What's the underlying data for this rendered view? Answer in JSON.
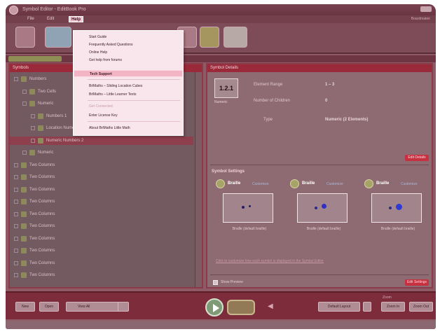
{
  "app": {
    "title": "Symbol Editor - EditBook Pro"
  },
  "menubar": {
    "file": "File",
    "edit": "Edit",
    "help": "Help",
    "right_text": "Boardmaker"
  },
  "help_menu": {
    "items": [
      {
        "label": "Start Guide"
      },
      {
        "label": "Frequently Asked Questions"
      },
      {
        "label": "Online Help"
      },
      {
        "label": "Get help from forums"
      },
      {
        "label": "Tech Support",
        "highlighted": true
      },
      {
        "label": "BrlMaths – Sliding Location Cubes"
      },
      {
        "label": "BrlMaths – Little Learner Texts"
      },
      {
        "label": "Get Connected",
        "disabled": true
      },
      {
        "label": "Enter License Key"
      },
      {
        "label": "About BrlMaths Little Math"
      }
    ]
  },
  "left_panel": {
    "header": "Symbols",
    "tree": [
      {
        "label": "Numbers",
        "level": 0
      },
      {
        "label": "Two Cells",
        "level": 1
      },
      {
        "label": "Numeric",
        "level": 1
      },
      {
        "label": "Numbers 1",
        "level": 2
      },
      {
        "label": "Location Numeric",
        "level": 2
      },
      {
        "label": "Numeric Numbers 2",
        "level": 2,
        "selected": true
      },
      {
        "label": "Numeric",
        "level": 1
      },
      {
        "label": "Two Columns",
        "level": 0
      },
      {
        "label": "Two Columns",
        "level": 0
      },
      {
        "label": "Two Columns",
        "level": 0
      },
      {
        "label": "Two Columns",
        "level": 0
      },
      {
        "label": "Two Columns",
        "level": 0
      },
      {
        "label": "Two Columns",
        "level": 0
      },
      {
        "label": "Two Columns",
        "level": 0
      },
      {
        "label": "Two Columns",
        "level": 0
      },
      {
        "label": "Two Columns",
        "level": 0
      },
      {
        "label": "Two Columns",
        "level": 0
      }
    ]
  },
  "right_panel": {
    "header": "Symbol Details",
    "symbol_preview": "1.2.1",
    "symbol_caption": "Numeric",
    "props": {
      "label_1": "Element Range",
      "value_1": "1 – 3",
      "label_2": "Number of Children",
      "value_2": "0",
      "label_3": "Type",
      "value_3": "Numeric (2 Elements)"
    },
    "edit_button_1": "Edit Details",
    "subsection_header": "Symbol Settings",
    "swatches": [
      {
        "name": "Braille",
        "link": "Customize",
        "caption": "Braille (default braille)",
        "color": "#3a3ad0"
      },
      {
        "name": "Braille",
        "link": "Customize",
        "caption": "Braille (default braille)",
        "color": "#2f2fc8"
      },
      {
        "name": "Braille",
        "link": "Customize",
        "caption": "Braille (default braille)",
        "color": "#2e3ad6"
      }
    ],
    "info_text": "Click to customize how each symbol is displayed in the Symbol Editor",
    "checkbox_label": "Show Preview",
    "edit_button_2": "Edit Settings"
  },
  "bottom_bar": {
    "btn_1": "New",
    "btn_2": "Open",
    "view_label": "View All",
    "layout_label": "Default Layout",
    "zoom_label": "Zoom",
    "zoom_a": "Zoom In",
    "zoom_b": "Zoom Out"
  }
}
